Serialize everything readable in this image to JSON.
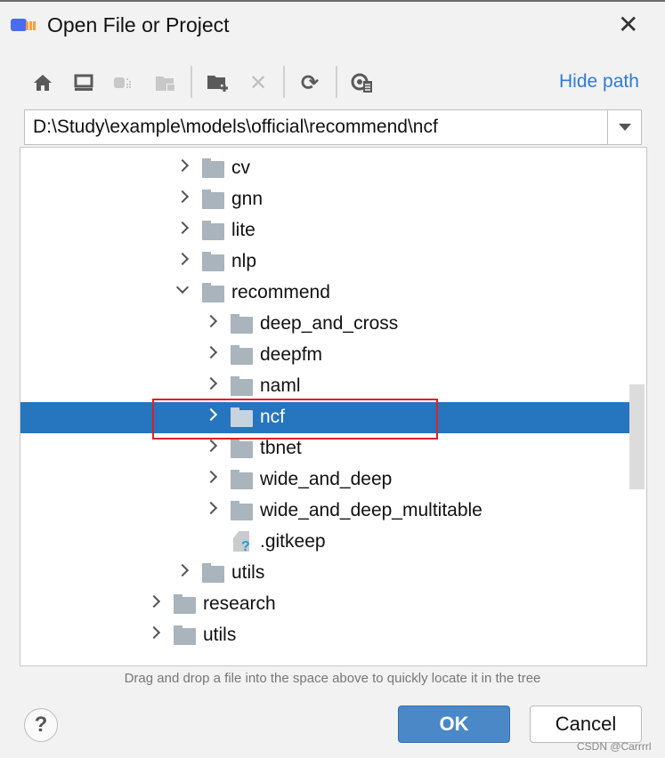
{
  "window": {
    "title": "Open File or Project",
    "close_icon": "close-icon",
    "accent": "#2675bf"
  },
  "toolbar": {
    "icons": [
      "home-icon",
      "desktop-icon",
      "project-icon",
      "module-folder-icon",
      "new-folder-icon",
      "delete-icon",
      "refresh-icon",
      "show-hidden-icon"
    ],
    "hide_path": "Hide path"
  },
  "path": {
    "value": "D:\\Study\\example\\models\\official\\recommend\\ncf"
  },
  "tree": {
    "rows": [
      {
        "label": "cv",
        "level": 1,
        "type": "folder",
        "expanded": false
      },
      {
        "label": "gnn",
        "level": 1,
        "type": "folder",
        "expanded": false
      },
      {
        "label": "lite",
        "level": 1,
        "type": "folder",
        "expanded": false
      },
      {
        "label": "nlp",
        "level": 1,
        "type": "folder",
        "expanded": false
      },
      {
        "label": "recommend",
        "level": 1,
        "type": "folder",
        "expanded": true
      },
      {
        "label": "deep_and_cross",
        "level": 2,
        "type": "folder",
        "expanded": false
      },
      {
        "label": "deepfm",
        "level": 2,
        "type": "folder",
        "expanded": false
      },
      {
        "label": "naml",
        "level": 2,
        "type": "folder",
        "expanded": false
      },
      {
        "label": "ncf",
        "level": 2,
        "type": "folder",
        "expanded": false,
        "selected": true
      },
      {
        "label": "tbnet",
        "level": 2,
        "type": "folder",
        "expanded": false
      },
      {
        "label": "wide_and_deep",
        "level": 2,
        "type": "folder",
        "expanded": false
      },
      {
        "label": "wide_and_deep_multitable",
        "level": 2,
        "type": "folder",
        "expanded": false
      },
      {
        "label": ".gitkeep",
        "level": 2,
        "type": "file"
      },
      {
        "label": "utils",
        "level": 1,
        "type": "folder",
        "expanded": false
      },
      {
        "label": "research",
        "level": 0,
        "type": "folder",
        "expanded": false
      },
      {
        "label": "utils",
        "level": 0,
        "type": "folder",
        "expanded": false
      }
    ]
  },
  "hint": "Drag and drop a file into the space above to quickly locate it in the tree",
  "buttons": {
    "help": "?",
    "ok": "OK",
    "cancel": "Cancel"
  },
  "watermark": "CSDN @Carrrrl"
}
